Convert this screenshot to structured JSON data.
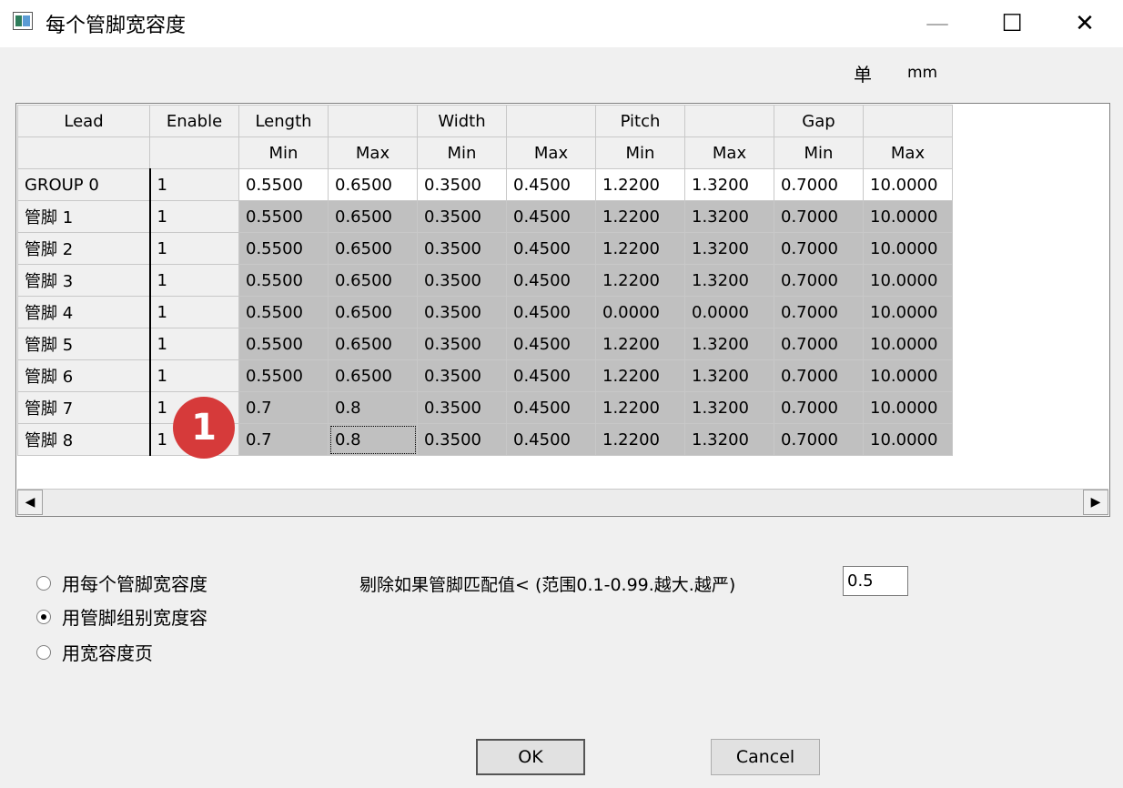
{
  "window": {
    "title": "每个管脚宽容度",
    "minimize_icon": "—",
    "maximize_icon": "☐",
    "close_icon": "✕"
  },
  "unit": {
    "label": "单",
    "value": "mm"
  },
  "grid": {
    "header_top": [
      "Lead",
      "Enable",
      "Length",
      "",
      "Width",
      "",
      "Pitch",
      "",
      "Gap",
      ""
    ],
    "header_sub": [
      "",
      "",
      "Min",
      "Max",
      "Min",
      "Max",
      "Min",
      "Max",
      "Min",
      "Max"
    ],
    "rows": [
      {
        "lead": "GROUP 0",
        "enable": "1",
        "values": [
          "0.5500",
          "0.6500",
          "0.3500",
          "0.4500",
          "1.2200",
          "1.3200",
          "0.7000",
          "10.0000"
        ]
      },
      {
        "lead": "管脚 1",
        "enable": "1",
        "values": [
          "0.5500",
          "0.6500",
          "0.3500",
          "0.4500",
          "1.2200",
          "1.3200",
          "0.7000",
          "10.0000"
        ]
      },
      {
        "lead": "管脚 2",
        "enable": "1",
        "values": [
          "0.5500",
          "0.6500",
          "0.3500",
          "0.4500",
          "1.2200",
          "1.3200",
          "0.7000",
          "10.0000"
        ]
      },
      {
        "lead": "管脚 3",
        "enable": "1",
        "values": [
          "0.5500",
          "0.6500",
          "0.3500",
          "0.4500",
          "1.2200",
          "1.3200",
          "0.7000",
          "10.0000"
        ]
      },
      {
        "lead": "管脚 4",
        "enable": "1",
        "values": [
          "0.5500",
          "0.6500",
          "0.3500",
          "0.4500",
          "0.0000",
          "0.0000",
          "0.7000",
          "10.0000"
        ]
      },
      {
        "lead": "管脚 5",
        "enable": "1",
        "values": [
          "0.5500",
          "0.6500",
          "0.3500",
          "0.4500",
          "1.2200",
          "1.3200",
          "0.7000",
          "10.0000"
        ]
      },
      {
        "lead": "管脚 6",
        "enable": "1",
        "values": [
          "0.5500",
          "0.6500",
          "0.3500",
          "0.4500",
          "1.2200",
          "1.3200",
          "0.7000",
          "10.0000"
        ]
      },
      {
        "lead": "管脚 7",
        "enable": "1",
        "values": [
          "0.7",
          "0.8",
          "0.3500",
          "0.4500",
          "1.2200",
          "1.3200",
          "0.7000",
          "10.0000"
        ]
      },
      {
        "lead": "管脚 8",
        "enable": "1",
        "values": [
          "0.7",
          "0.8",
          "0.3500",
          "0.4500",
          "1.2200",
          "1.3200",
          "0.7000",
          "10.0000"
        ]
      }
    ],
    "scroll_left_icon": "◀",
    "scroll_right_icon": "▶"
  },
  "badge": {
    "label": "1",
    "color": "#d63a3a"
  },
  "options": {
    "items": [
      {
        "label": "用每个管脚宽容度",
        "checked": false
      },
      {
        "label": "用管脚组别宽度容",
        "checked": true
      },
      {
        "label": "用宽容度页",
        "checked": false
      }
    ]
  },
  "reject": {
    "label": "剔除如果管脚匹配值< (范围0.1-0.99.越大.越严)",
    "value": "0.5"
  },
  "buttons": {
    "ok": "OK",
    "cancel": "Cancel"
  }
}
